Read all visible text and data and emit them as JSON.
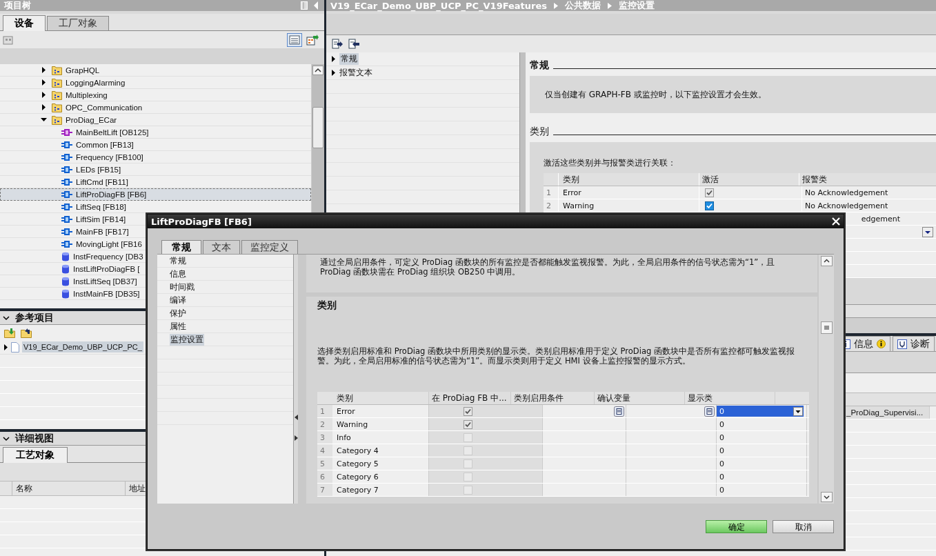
{
  "project_tree": {
    "title": "项目树",
    "tabs": [
      {
        "label": "设备",
        "selected": true
      },
      {
        "label": "工厂对象",
        "selected": false
      }
    ],
    "items": [
      {
        "label": "GrapHQL",
        "kind": "folder",
        "expanded": false,
        "selected": false
      },
      {
        "label": "LoggingAlarming",
        "kind": "folder",
        "expanded": false,
        "selected": false
      },
      {
        "label": "Multiplexing",
        "kind": "folder",
        "expanded": false,
        "selected": false
      },
      {
        "label": "OPC_Communication",
        "kind": "folder",
        "expanded": false,
        "selected": false
      },
      {
        "label": "ProDiag_ECar",
        "kind": "folder",
        "expanded": true,
        "selected": false,
        "children": [
          {
            "label": "MainBeltLift [OB125]",
            "kind": "ob",
            "selected": false
          },
          {
            "label": "Common [FB13]",
            "kind": "fb",
            "selected": false
          },
          {
            "label": "Frequency [FB100]",
            "kind": "fb",
            "selected": false
          },
          {
            "label": "LEDs [FB15]",
            "kind": "fb",
            "selected": false
          },
          {
            "label": "LiftCmd [FB11]",
            "kind": "fb",
            "selected": false
          },
          {
            "label": "LiftProDiagFB [FB6]",
            "kind": "fb",
            "selected": true
          },
          {
            "label": "LiftSeq [FB18]",
            "kind": "fb",
            "selected": false
          },
          {
            "label": "LiftSim [FB14]",
            "kind": "fb",
            "selected": false
          },
          {
            "label": "MainFB [FB17]",
            "kind": "fb",
            "selected": false
          },
          {
            "label": "MovingLight [FB16",
            "kind": "fb",
            "selected": false
          },
          {
            "label": "InstFrequency [DB3",
            "kind": "db",
            "selected": false
          },
          {
            "label": "InstLiftProDiagFB [",
            "kind": "db",
            "selected": false
          },
          {
            "label": "InstLiftSeq [DB37]",
            "kind": "db",
            "selected": false
          },
          {
            "label": "InstMainFB [DB35]",
            "kind": "db",
            "selected": false
          }
        ]
      }
    ]
  },
  "reference_projects": {
    "title": "参考项目",
    "items": [
      {
        "label": "V19_ECar_Demo_UBP_UCP_PC_",
        "selected": true
      }
    ]
  },
  "details_view": {
    "title": "详细视图",
    "tabs": [
      {
        "label": "工艺对象",
        "selected": true
      }
    ],
    "columns": [
      "名称",
      "地址"
    ]
  },
  "breadcrumb": [
    "V19_ECar_Demo_UBP_UCP_PC_V19Features",
    "公共数据",
    "监控设置"
  ],
  "editor_nav": [
    {
      "label": "常规",
      "selected": true
    },
    {
      "label": "报警文本",
      "selected": false
    }
  ],
  "general": {
    "title": "常规",
    "text": "仅当创建有 GRAPH-FB 或监控时，以下监控设置才会生效。"
  },
  "categories": {
    "title": "类别",
    "text": "激活这些类别并与报警类进行关联：",
    "columns": [
      "类别",
      "激活",
      "报警类"
    ],
    "rows": [
      {
        "kind": "full",
        "no": "1",
        "category": "Error",
        "active": true,
        "disabled": true,
        "alarm_class": "No Acknowledgement"
      },
      {
        "kind": "full",
        "no": "2",
        "category": "Warning",
        "active": true,
        "disabled": false,
        "alarm_class": "No Acknowledgement"
      },
      {
        "kind": "partial",
        "alarm_class": "edgement"
      }
    ]
  },
  "inspector_tabs": [
    {
      "label": "信息",
      "kind": "info"
    },
    {
      "label": "诊断",
      "kind": "diag"
    }
  ],
  "cross_reference_cell": "_ProDiag_Supervisi...",
  "dialog": {
    "title": "LiftProDiagFB [FB6]",
    "tabs": [
      {
        "label": "常规",
        "selected": true
      },
      {
        "label": "文本",
        "selected": false
      },
      {
        "label": "监控定义",
        "selected": false
      }
    ],
    "nav": [
      {
        "label": "常规",
        "selected": false
      },
      {
        "label": "信息",
        "selected": false
      },
      {
        "label": "时间戳",
        "selected": false
      },
      {
        "label": "编译",
        "selected": false
      },
      {
        "label": "保护",
        "selected": false
      },
      {
        "label": "属性",
        "selected": false
      },
      {
        "label": "监控设置",
        "selected": true
      }
    ],
    "intro": "通过全局启用条件，可定义 ProDiag 函数块的所有监控是否都能触发监视报警。为此，全局启用条件的信号状态需为“1”，且 ProDiag 函数块需在 ProDiag 组织块 OB250 中调用。",
    "section_title": "类别",
    "description": "选择类别启用标准和 ProDiag 函数块中所用类别的显示类。类别启用标准用于定义 ProDiag 函数块中是否所有监控都可触发监视报警。为此，全局启用标准的信号状态需为“1”。而显示类则用于定义 HMI 设备上监控报警的显示方式。",
    "columns": [
      "类别",
      "在 ProDiag FB 中...",
      "类别启用条件",
      "确认变量",
      "显示类"
    ],
    "rows": [
      {
        "no": "1",
        "category": "Error",
        "used": true,
        "display_class": "0",
        "selected": true
      },
      {
        "no": "2",
        "category": "Warning",
        "used": true,
        "display_class": "0",
        "selected": false
      },
      {
        "no": "3",
        "category": "Info",
        "used": false,
        "display_class": "0",
        "selected": false
      },
      {
        "no": "4",
        "category": "Category 4",
        "used": false,
        "display_class": "0",
        "selected": false
      },
      {
        "no": "5",
        "category": "Category 5",
        "used": false,
        "display_class": "0",
        "selected": false
      },
      {
        "no": "6",
        "category": "Category 6",
        "used": false,
        "display_class": "0",
        "selected": false
      },
      {
        "no": "7",
        "category": "Category 7",
        "used": false,
        "display_class": "0",
        "selected": false
      }
    ],
    "buttons": [
      {
        "label": "确定",
        "kind": "primary"
      },
      {
        "label": "取消",
        "kind": "secondary"
      }
    ]
  }
}
